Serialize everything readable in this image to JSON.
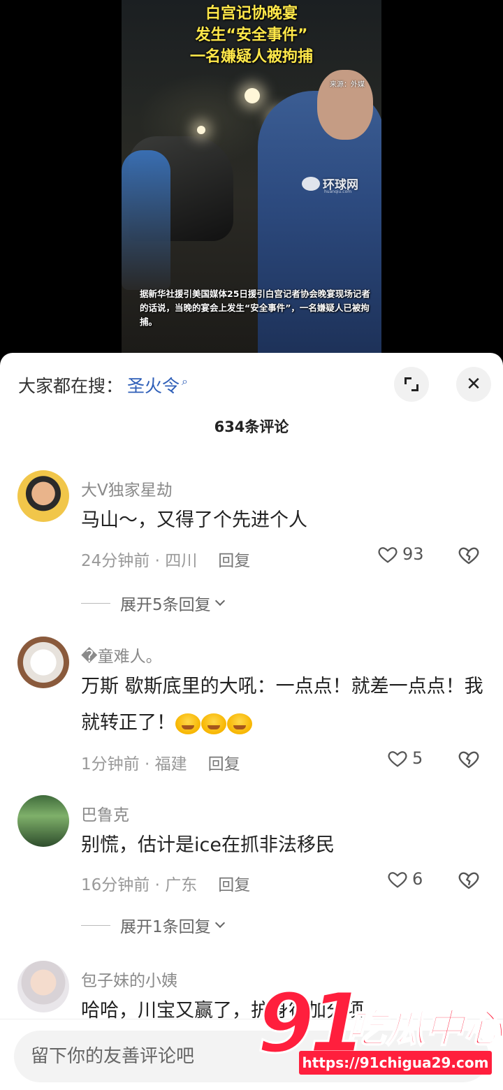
{
  "video": {
    "headline_lines": [
      "白宫记协晚宴",
      "发生“安全事件”",
      "一名嫌疑人被拘捕"
    ],
    "source": "来源：外媒",
    "logo": "环球网",
    "logo_sub": "huanqiu.com",
    "caption": "据新华社援引美国媒体25日援引白宫记者协会晚宴现场记者的话说，当晚的宴会上发生“安全事件”，一名嫌疑人已被拘捕。"
  },
  "sheet": {
    "search_prefix": "大家都在搜：",
    "search_term": "圣火令",
    "comment_count": "634条评论"
  },
  "comments": [
    {
      "username": "大V独家星劫",
      "text": "马山～，又得了个先进个人",
      "time_location": "24分钟前 · 四川",
      "reply_label": "回复",
      "likes": "93",
      "expand_label": "展开5条回复"
    },
    {
      "username": "�童难人。",
      "text": "万斯 歇斯底里的大吼：一点点！就差一点点！我就转正了！",
      "time_location": "1分钟前 · 福建",
      "reply_label": "回复",
      "likes": "5"
    },
    {
      "username": "巴鲁克",
      "text": "别慌，估计是ice在抓非法移民",
      "time_location": "16分钟前 · 广东",
      "reply_label": "回复",
      "likes": "6",
      "expand_label": "展开1条回复"
    },
    {
      "username": "包子妹的小姨",
      "text": "哈哈，川宝又赢了，护身符加分项"
    }
  ],
  "input": {
    "placeholder": "留下你的友善评论吧"
  },
  "watermark": {
    "number": "91",
    "name": "吃瓜中心",
    "url": "https://91chigua29.com"
  },
  "colors": {
    "accent_blue": "#2f5fb8",
    "headline_yellow": "#ffe84a",
    "watermark_red": "#ff1f3d"
  }
}
